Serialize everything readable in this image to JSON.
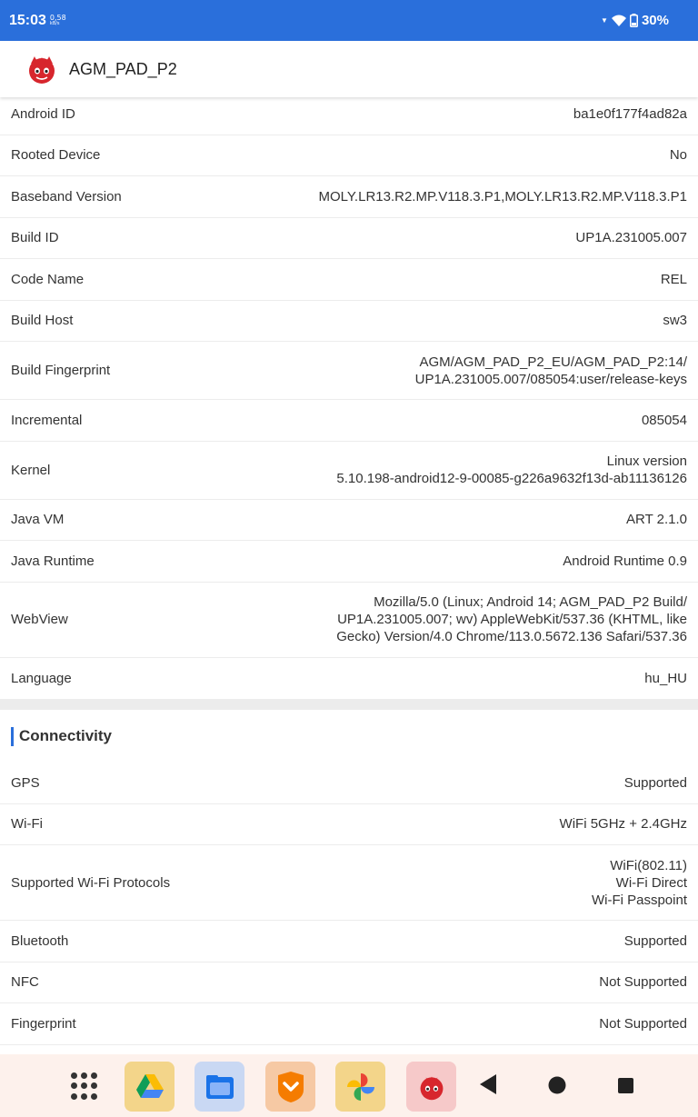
{
  "status_bar": {
    "time": "15:03",
    "net_speed": "0,58",
    "net_unit": "kB/s",
    "battery": "30%"
  },
  "app_bar": {
    "title": "AGM_PAD_P2"
  },
  "system_rows": [
    {
      "label": "Android ID",
      "value": "ba1e0f177f4ad82a"
    },
    {
      "label": "Rooted Device",
      "value": "No"
    },
    {
      "label": "Baseband Version",
      "value": "MOLY.LR13.R2.MP.V118.3.P1,MOLY.LR13.R2.MP.V118.3.P1"
    },
    {
      "label": "Build ID",
      "value": "UP1A.231005.007"
    },
    {
      "label": "Code Name",
      "value": "REL"
    },
    {
      "label": "Build Host",
      "value": "sw3"
    },
    {
      "label": "Build Fingerprint",
      "value": "AGM/AGM_PAD_P2_EU/AGM_PAD_P2:14/\nUP1A.231005.007/085054:user/release-keys"
    },
    {
      "label": "Incremental",
      "value": "085054"
    },
    {
      "label": "Kernel",
      "value": "Linux version\n5.10.198-android12-9-00085-g226a9632f13d-ab11136126"
    },
    {
      "label": "Java VM",
      "value": "ART 2.1.0"
    },
    {
      "label": "Java Runtime",
      "value": "Android Runtime 0.9"
    },
    {
      "label": "WebView",
      "value": "Mozilla/5.0 (Linux; Android 14; AGM_PAD_P2 Build/\nUP1A.231005.007; wv) AppleWebKit/537.36 (KHTML, like\nGecko) Version/4.0 Chrome/113.0.5672.136 Safari/537.36"
    },
    {
      "label": "Language",
      "value": "hu_HU"
    }
  ],
  "connectivity": {
    "title": "Connectivity",
    "rows": [
      {
        "label": "GPS",
        "value": "Supported"
      },
      {
        "label": "Wi-Fi",
        "value": "WiFi 5GHz + 2.4GHz"
      },
      {
        "label": "Supported Wi-Fi Protocols",
        "value": "WiFi(802.11)\nWi-Fi Direct\nWi-Fi Passpoint"
      },
      {
        "label": "Bluetooth",
        "value": "Supported"
      },
      {
        "label": "NFC",
        "value": "Not Supported"
      },
      {
        "label": "Fingerprint",
        "value": "Not Supported"
      }
    ]
  },
  "dock": {
    "apps": [
      "drive-icon",
      "files-icon",
      "launcher-icon",
      "photos-icon",
      "antutu-icon"
    ],
    "colors": {
      "accent": "#2a6fdb",
      "dock_bg": "#fdf1ec"
    }
  }
}
